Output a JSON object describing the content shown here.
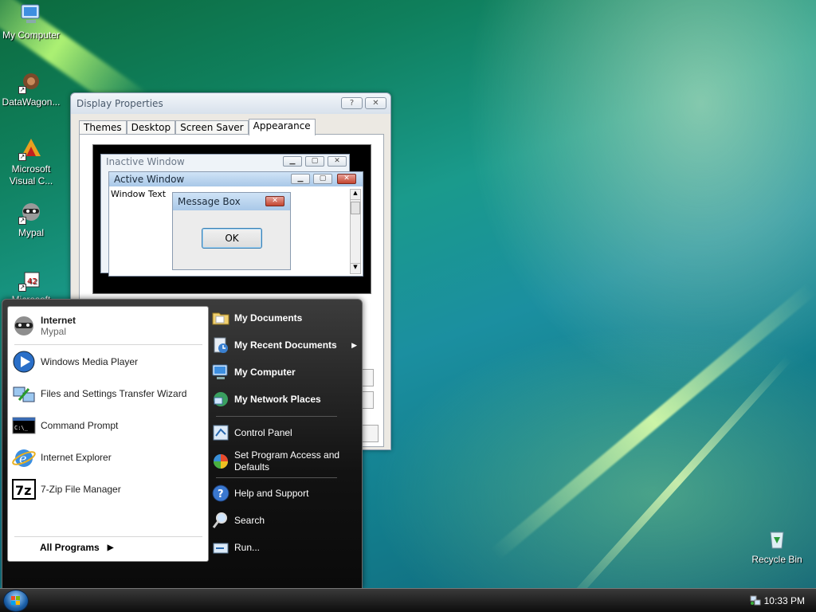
{
  "desktop": {
    "icons": [
      {
        "label": "My Computer"
      },
      {
        "label": "DataWagon..."
      },
      {
        "label": "Microsoft Visual C..."
      },
      {
        "label": "Mypal"
      },
      {
        "label": "Microsoft"
      },
      {
        "label": "Recycle Bin"
      }
    ]
  },
  "dialog": {
    "title": "Display Properties",
    "help_label": "?",
    "close_label": "✕",
    "tabs": [
      {
        "label": "Themes"
      },
      {
        "label": "Desktop"
      },
      {
        "label": "Screen Saver"
      },
      {
        "label": "Appearance"
      }
    ],
    "preview": {
      "inactive_title": "Inactive Window",
      "active_title": "Active Window",
      "window_text": "Window Text",
      "message_title": "Message Box",
      "ok_label": "OK"
    }
  },
  "start_menu": {
    "pinned": {
      "title": "Internet",
      "subtitle": "Mypal"
    },
    "recent": [
      {
        "label": "Windows Media Player",
        "icon": "media-player-icon"
      },
      {
        "label": "Files and Settings Transfer Wizard",
        "icon": "transfer-wizard-icon"
      },
      {
        "label": "Command Prompt",
        "icon": "command-prompt-icon"
      },
      {
        "label": "Internet Explorer",
        "icon": "internet-explorer-icon"
      },
      {
        "label": "7-Zip File Manager",
        "icon": "7zip-icon"
      }
    ],
    "all_programs": "All Programs",
    "right": [
      {
        "label": "My Documents"
      },
      {
        "label": "My Recent Documents"
      },
      {
        "label": "My Computer"
      },
      {
        "label": "My Network Places"
      },
      {
        "label": "Control Panel"
      },
      {
        "label": "Set Program Access and Defaults"
      },
      {
        "label": "Help and Support"
      },
      {
        "label": "Search"
      },
      {
        "label": "Run..."
      }
    ]
  },
  "taskbar": {
    "clock": "10:33 PM"
  }
}
